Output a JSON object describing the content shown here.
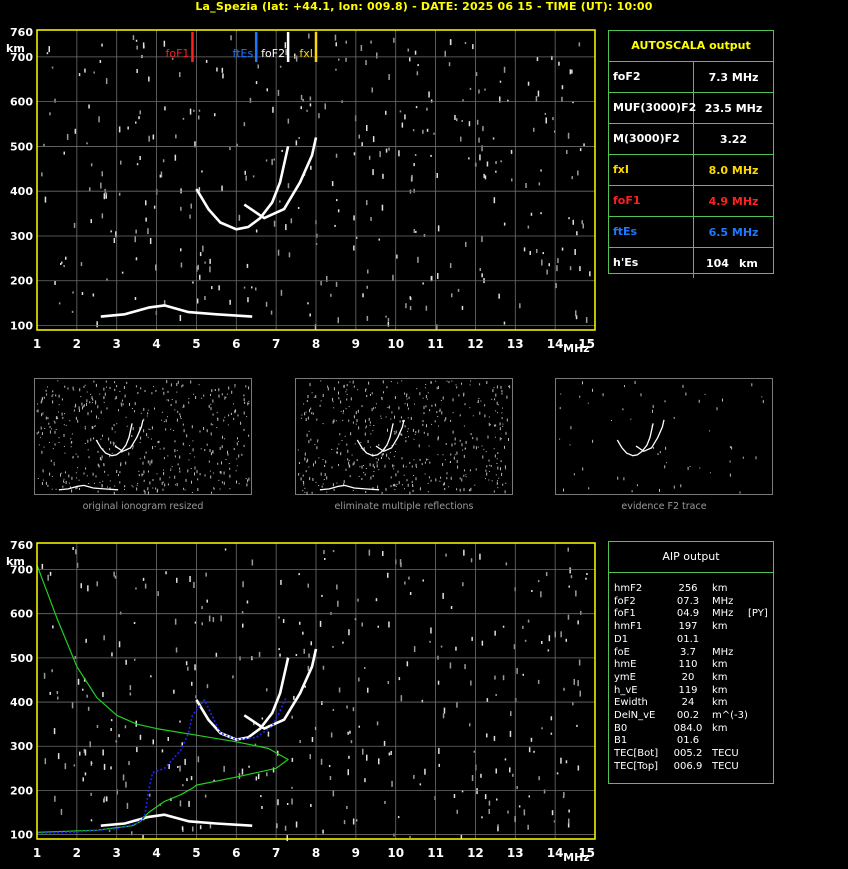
{
  "title": "La_Spezia (lat: +44.1, lon: 009.8) - DATE: 2025 06 15 - TIME (UT): 10:00",
  "colors": {
    "frame": "#ffff00",
    "grid": "#6e6e6e",
    "trace": "#ffffff",
    "foF1": "#ff2020",
    "ftEs": "#1e78ff",
    "foF2": "#ffffff",
    "fxI": "#ffd800",
    "profile": "#21d021",
    "aip_trace": "#2020ff",
    "panel_border": "#52c352"
  },
  "axes": {
    "x_ticks": [
      "1",
      "2",
      "3",
      "4",
      "5",
      "6",
      "7",
      "8",
      "9",
      "10",
      "11",
      "12",
      "13",
      "14",
      "15"
    ],
    "x_unit": "MHz",
    "y_ticks": [
      "100",
      "200",
      "300",
      "400",
      "500",
      "600",
      "700"
    ],
    "y_top": "760",
    "y_unit": "km"
  },
  "chart_data": [
    {
      "type": "scatter",
      "xlim": [
        1,
        15
      ],
      "ylim": [
        90,
        760
      ],
      "markers": [
        {
          "label": "foF1",
          "x": 4.9,
          "color": "#ff2020"
        },
        {
          "label": "ftEs",
          "x": 6.5,
          "color": "#1e78ff"
        },
        {
          "label": "foF2",
          "x": 7.3,
          "color": "#ffffff"
        },
        {
          "label": "fxI",
          "x": 8.0,
          "color": "#ffd800"
        }
      ],
      "series": [
        {
          "values": [
            [
              5.0,
              405
            ],
            [
              5.3,
              360
            ],
            [
              5.6,
              330
            ],
            [
              6.0,
              315
            ],
            [
              6.3,
              320
            ],
            [
              6.6,
              340
            ],
            [
              6.9,
              375
            ],
            [
              7.1,
              420
            ],
            [
              7.3,
              500
            ]
          ]
        },
        {
          "values": [
            [
              6.2,
              370
            ],
            [
              6.7,
              340
            ],
            [
              7.2,
              360
            ],
            [
              7.6,
              420
            ],
            [
              7.9,
              480
            ],
            [
              8.0,
              520
            ]
          ]
        },
        {
          "values": [
            [
              2.6,
              120
            ],
            [
              3.2,
              125
            ],
            [
              3.8,
              140
            ],
            [
              4.2,
              145
            ],
            [
              4.8,
              130
            ],
            [
              5.5,
              125
            ],
            [
              6.4,
              120
            ]
          ]
        }
      ]
    },
    {
      "type": "scatter",
      "xlim": [
        1,
        15
      ],
      "ylim": [
        90,
        760
      ],
      "series": [
        {
          "values": [
            [
              5.0,
              405
            ],
            [
              5.3,
              360
            ],
            [
              5.6,
              330
            ],
            [
              6.0,
              315
            ],
            [
              6.3,
              320
            ],
            [
              6.6,
              340
            ],
            [
              6.9,
              375
            ],
            [
              7.1,
              420
            ],
            [
              7.3,
              500
            ]
          ]
        },
        {
          "values": [
            [
              6.2,
              370
            ],
            [
              6.7,
              340
            ],
            [
              7.2,
              360
            ],
            [
              7.6,
              420
            ],
            [
              7.9,
              480
            ],
            [
              8.0,
              520
            ]
          ]
        },
        {
          "values": [
            [
              2.6,
              120
            ],
            [
              3.2,
              125
            ],
            [
              3.8,
              140
            ],
            [
              4.2,
              145
            ],
            [
              4.8,
              130
            ],
            [
              5.5,
              125
            ],
            [
              6.4,
              120
            ]
          ]
        },
        {
          "values": [
            [
              1.0,
              710
            ],
            [
              1.5,
              590
            ],
            [
              2.0,
              480
            ],
            [
              2.5,
              410
            ],
            [
              3.0,
              370
            ],
            [
              3.5,
              350
            ],
            [
              4.0,
              340
            ],
            [
              5.0,
              325
            ],
            [
              6.0,
              310
            ],
            [
              6.8,
              295
            ],
            [
              7.3,
              270
            ],
            [
              7.0,
              250
            ],
            [
              6.0,
              230
            ],
            [
              5.0,
              212
            ],
            [
              4.9,
              205
            ],
            [
              4.6,
              190
            ],
            [
              4.2,
              175
            ],
            [
              3.8,
              150
            ],
            [
              3.6,
              130
            ],
            [
              3.4,
              120
            ],
            [
              2.5,
              110
            ],
            [
              1.0,
              105
            ]
          ]
        },
        {
          "values": [
            [
              1.0,
              103
            ],
            [
              2.0,
              106
            ],
            [
              3.0,
              113
            ],
            [
              3.5,
              125
            ],
            [
              3.7,
              140
            ],
            [
              3.8,
              200
            ],
            [
              3.9,
              240
            ],
            [
              4.2,
              250
            ],
            [
              4.6,
              290
            ],
            [
              4.8,
              330
            ],
            [
              4.9,
              370
            ],
            [
              5.2,
              405
            ],
            [
              5.6,
              330
            ],
            [
              6.0,
              315
            ],
            [
              6.5,
              320
            ],
            [
              6.9,
              345
            ],
            [
              7.1,
              380
            ],
            [
              7.25,
              410
            ]
          ]
        }
      ]
    }
  ],
  "autoscala": {
    "header": "AUTOSCALA output",
    "rows": [
      {
        "label": "foF2",
        "value": "7.3 MHz",
        "color": "#ffffff"
      },
      {
        "label": "MUF(3000)F2",
        "value": "23.5 MHz",
        "color": "#ffffff"
      },
      {
        "label": "M(3000)F2",
        "value": "3.22",
        "color": "#ffffff"
      },
      {
        "label": "fxI",
        "value": "8.0 MHz",
        "color": "#ffd800"
      },
      {
        "label": "foF1",
        "value": "4.9 MHz",
        "color": "#ff2020"
      },
      {
        "label": "ftEs",
        "value": "6.5 MHz",
        "color": "#1e78ff"
      },
      {
        "label": "h'Es",
        "value": "104",
        "unit": "km",
        "color": "#ffffff"
      }
    ]
  },
  "thumbnails": [
    {
      "caption": "original ionogram resized"
    },
    {
      "caption": "eliminate multiple reflections"
    },
    {
      "caption": "evidence F2 trace"
    }
  ],
  "aip": {
    "header": "AIP output",
    "rows": [
      {
        "k": "hmF2",
        "v": "256",
        "u": "km"
      },
      {
        "k": "foF2",
        "v": "07.3",
        "u": "MHz"
      },
      {
        "k": "foF1",
        "v": "04.9",
        "u": "MHz",
        "extra": "[PY]"
      },
      {
        "k": "hmF1",
        "v": "197",
        "u": "km"
      },
      {
        "k": "D1",
        "v": "01.1",
        "u": ""
      },
      {
        "k": "foE",
        "v": "3.7",
        "u": "MHz"
      },
      {
        "k": "hmE",
        "v": "110",
        "u": "km"
      },
      {
        "k": "ymE",
        "v": "20",
        "u": "km"
      },
      {
        "k": "h_vE",
        "v": "119",
        "u": "km"
      },
      {
        "k": "Ewidth",
        "v": "24",
        "u": "km"
      },
      {
        "k": "DelN_vE",
        "v": "00.2",
        "u": "m^(-3)"
      },
      {
        "k": "B0",
        "v": "084.0",
        "u": "km"
      },
      {
        "k": "B1",
        "v": "01.6",
        "u": ""
      },
      {
        "k": "TEC[Bot]",
        "v": "005.2",
        "u": "TECU"
      },
      {
        "k": "TEC[Top]",
        "v": "006.9",
        "u": "TECU"
      }
    ]
  }
}
